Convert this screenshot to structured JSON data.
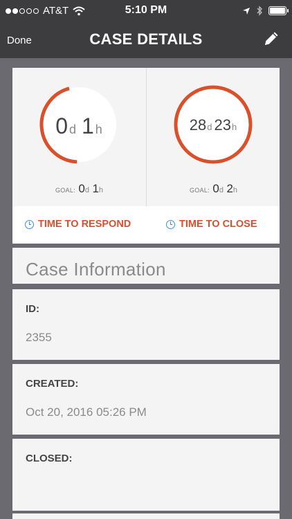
{
  "status_bar": {
    "carrier": "AT&T",
    "time": "5:10 PM",
    "signal_bars_filled": 2,
    "signal_bars_total": 5,
    "battery_level": 1.0
  },
  "nav": {
    "done_label": "Done",
    "title": "CASE DETAILS",
    "edit_icon": "pencil-icon"
  },
  "sla": {
    "respond": {
      "days": "0",
      "hours": "1",
      "day_unit": "d",
      "hour_unit": "h",
      "goal_label": "GOAL:",
      "goal_days": "0",
      "goal_hours": "1",
      "progress": 0.45,
      "tab_label": "TIME TO RESPOND"
    },
    "close": {
      "days": "28",
      "hours": "23",
      "day_unit": "d",
      "hour_unit": "h",
      "goal_label": "GOAL:",
      "goal_days": "0",
      "goal_hours": "2",
      "progress": 1.0,
      "tab_label": "TIME TO CLOSE"
    },
    "ring_color": "#d9502b",
    "clock_color": "#3a8fd6"
  },
  "section": {
    "title": "Case Information"
  },
  "fields": {
    "id": {
      "label": "ID:",
      "value": "2355"
    },
    "created": {
      "label": "CREATED:",
      "value": "Oct 20, 2016 05:26 PM"
    },
    "closed": {
      "label": "CLOSED:",
      "value": ""
    }
  }
}
